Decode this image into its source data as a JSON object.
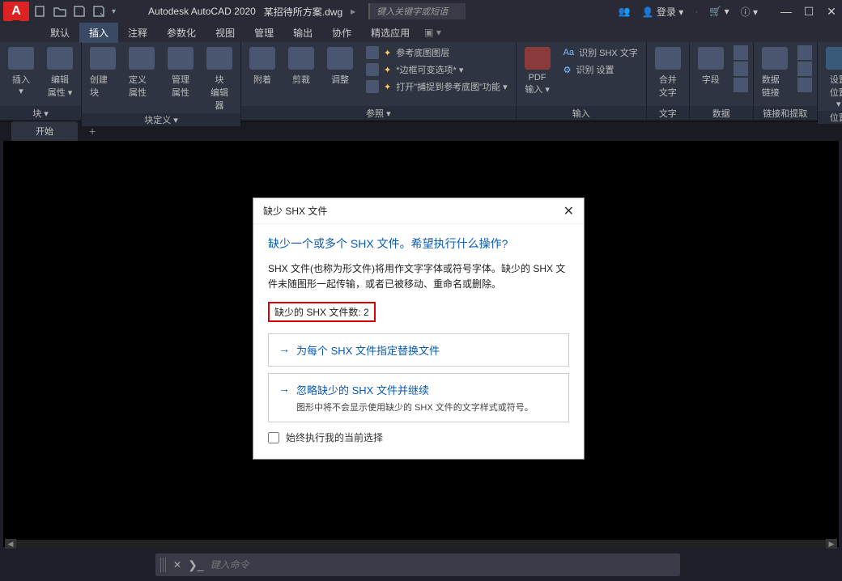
{
  "title": {
    "app": "Autodesk AutoCAD 2020",
    "file": "某招待所方案.dwg",
    "search_placeholder": "键入关键字或短语",
    "login": "登录",
    "app_logo": "A"
  },
  "menu": {
    "items": [
      "默认",
      "插入",
      "注释",
      "参数化",
      "视图",
      "管理",
      "输出",
      "协作",
      "精选应用"
    ],
    "active_index": 1
  },
  "ribbon": {
    "panels": [
      {
        "label": "块 ▾",
        "big": [
          {
            "name": "insert",
            "label": "插入\n▾"
          },
          {
            "name": "edit-attrib",
            "label": "编辑\n属性 ▾"
          }
        ]
      },
      {
        "label": "块定义 ▾",
        "big": [
          {
            "name": "create-block",
            "label": "创建块"
          },
          {
            "name": "define-attrib",
            "label": "定义属性"
          },
          {
            "name": "manage-attrib",
            "label": "管理\n属性"
          },
          {
            "name": "block-editor",
            "label": "块\n编辑器"
          }
        ]
      },
      {
        "label": "参照 ▾",
        "big": [
          {
            "name": "attach",
            "label": "附着"
          },
          {
            "name": "clip",
            "label": "剪裁"
          },
          {
            "name": "adjust",
            "label": "调整"
          }
        ],
        "small": [
          {
            "name": "underlay-layers",
            "label": "参考底图图层"
          },
          {
            "name": "frames-vary",
            "label": "*边框可变选项* ▾"
          },
          {
            "name": "snap-underlay",
            "label": "打开\"捕捉到参考底图\"功能 ▾"
          }
        ]
      },
      {
        "label": "输入",
        "big": [
          {
            "name": "pdf-import",
            "label": "PDF\n输入 ▾"
          }
        ],
        "small": [
          {
            "name": "recognize-shx",
            "label": "识别 SHX 文字"
          },
          {
            "name": "recognize-settings",
            "label": "识别 设置"
          }
        ]
      },
      {
        "label": "文字",
        "big": [
          {
            "name": "merge-text",
            "label": "合并\n文字"
          }
        ]
      },
      {
        "label": "数据",
        "big": [
          {
            "name": "field",
            "label": "字段"
          }
        ]
      },
      {
        "label": "链接和提取",
        "big": [
          {
            "name": "data-link",
            "label": "数据链接"
          }
        ]
      },
      {
        "label": "位置",
        "big": [
          {
            "name": "set-location",
            "label": "设置位置\n▾"
          }
        ]
      }
    ]
  },
  "doctabs": {
    "items": [
      "开始"
    ]
  },
  "dialog": {
    "title": "缺少 SHX 文件",
    "heading": "缺少一个或多个 SHX 文件。希望执行什么操作?",
    "desc": "SHX 文件(也称为形文件)将用作文字字体或符号字体。缺少的 SHX 文件未随图形一起传输，或者已被移动、重命名或删除。",
    "count_label": "缺少的 SHX 文件数: 2",
    "options": [
      {
        "title": "为每个 SHX 文件指定替换文件",
        "sub": ""
      },
      {
        "title": "忽略缺少的 SHX 文件并继续",
        "sub": "图形中将不会显示使用缺少的 SHX 文件的文字样式或符号。"
      }
    ],
    "checkbox": "始终执行我的当前选择"
  },
  "cmd": {
    "placeholder": "键入命令"
  }
}
